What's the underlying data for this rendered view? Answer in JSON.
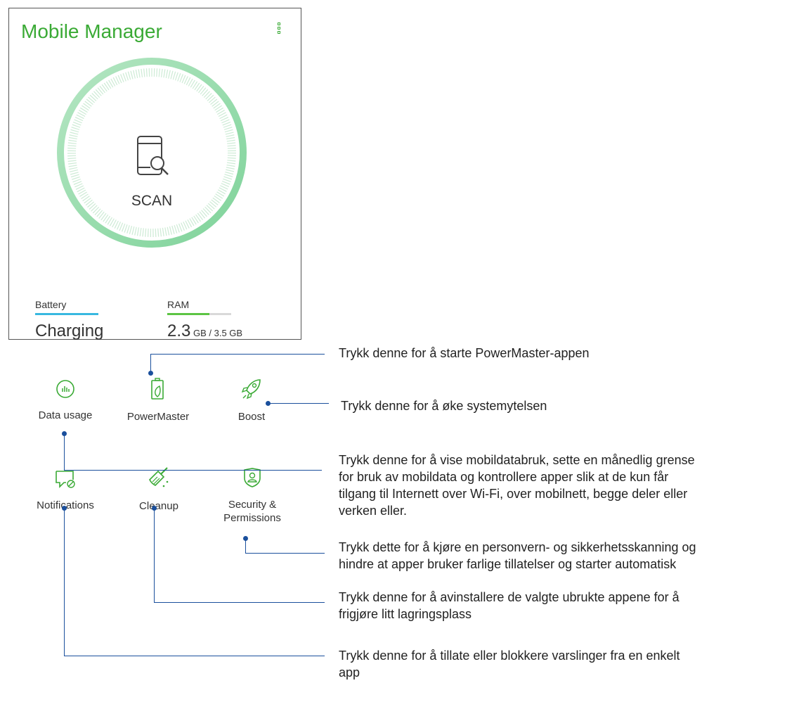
{
  "app": {
    "title": "Mobile Manager",
    "menu_icon": "overflow-menu-icon",
    "accent_color": "#3aaa35",
    "scan_label": "SCAN"
  },
  "stats": {
    "battery": {
      "label": "Battery",
      "value": "Charging"
    },
    "ram": {
      "label": "RAM",
      "value": "2.3",
      "unit": " GB / 3.5 GB",
      "used_fraction": 0.66
    }
  },
  "tiles": [
    {
      "label": "Data usage",
      "icon": "data-usage-icon"
    },
    {
      "label": "PowerMaster",
      "icon": "battery-leaf-icon"
    },
    {
      "label": "Boost",
      "icon": "rocket-icon"
    },
    {
      "label": "Notifications",
      "icon": "notifications-icon"
    },
    {
      "label": "Cleanup",
      "icon": "broom-icon"
    },
    {
      "label": "Security &",
      "label2": "Permissions",
      "icon": "shield-user-icon"
    }
  ],
  "annotations": {
    "powermaster": "Trykk denne for å starte PowerMaster-appen",
    "boost": "Trykk denne for å øke systemytelsen",
    "data_usage": [
      "Trykk denne for å vise mobildatabruk, sette en månedlig grense",
      "for bruk av mobildata og kontrollere apper slik at de kun får",
      "tilgang til Internett over Wi-Fi, over mobilnett, begge deler eller",
      "verken eller."
    ],
    "security": [
      "Trykk dette for å kjøre en personvern- og sikkerhetsskanning og",
      "hindre at apper bruker farlige tillatelser og starter automatisk"
    ],
    "cleanup": [
      "Trykk denne for å avinstallere de valgte ubrukte appene for å",
      "frigjøre litt lagringsplass"
    ],
    "notifications": [
      "Trykk denne for å tillate eller blokkere varslinger fra en enkelt",
      "app"
    ],
    "line_color": "#1a4f9c"
  }
}
